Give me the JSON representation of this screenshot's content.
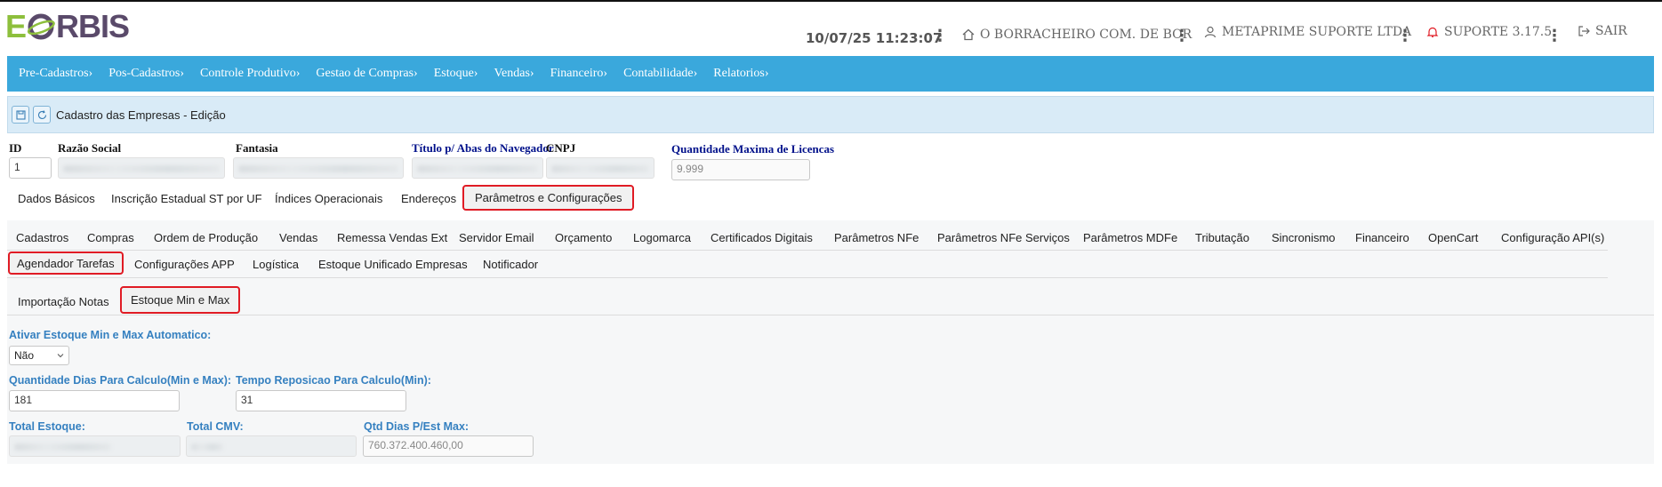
{
  "header": {
    "logo_e": "E",
    "logo_rest": "RBIS",
    "datetime": "10/07/25 11:23:07",
    "company": "O BORRACHEIRO COM. DE BOR",
    "user": "METAPRIME SUPORTE LTDA",
    "support": "SUPORTE 3.17.5",
    "logout": "SAIR"
  },
  "menu": [
    "Pre-Cadastros›",
    "Pos-Cadastros›",
    "Controle Produtivo›",
    "Gestao de Compras›",
    "Estoque›",
    "Vendas›",
    "Financeiro›",
    "Contabilidade›",
    "Relatorios›"
  ],
  "toolbar": {
    "title": "Cadastro das Empresas - Edição"
  },
  "fields": {
    "id_label": "ID",
    "id_value": "1",
    "razao_label": "Razão Social",
    "fantasia_label": "Fantasia",
    "titulo_label": "Título p/ Abas do Navegador",
    "cnpj_label": "CNPJ",
    "licencas_label": "Quantidade Maxima de Licencas",
    "licencas_placeholder": "9.999"
  },
  "main_tabs": [
    "Dados Básicos",
    "Inscrição Estadual ST por UF",
    "Índices Operacionais",
    "Endereços",
    "Parâmetros e Configurações"
  ],
  "param_tabs_row1": [
    "Cadastros",
    "Compras",
    "Ordem de Produção",
    "Vendas",
    "Remessa Vendas Ext",
    "Servidor Email",
    "Orçamento",
    "Logomarca",
    "Certificados Digitais",
    "Parâmetros NFe",
    "Parâmetros NFe Serviços",
    "Parâmetros MDFe",
    "Tributação",
    "Sincronismo",
    "Financeiro",
    "OpenCart",
    "Configuração API(s)"
  ],
  "param_tabs_row2": [
    "Agendador Tarefas",
    "Configurações APP",
    "Logística",
    "Estoque Unificado Empresas",
    "Notificador"
  ],
  "sub_tabs": [
    "Importação Notas",
    "Estoque Min e Max"
  ],
  "estoque": {
    "ativar_label": "Ativar Estoque Min e Max Automatico:",
    "ativar_value": "Não",
    "dias_label": "Quantidade Dias Para Calculo(Min e Max):",
    "dias_value": "181",
    "reposicao_label": "Tempo Reposicao Para Calculo(Min):",
    "reposicao_value": "31",
    "total_estoque_label": "Total Estoque:",
    "total_cmv_label": "Total CMV:",
    "qtd_dias_label": "Qtd Dias P/Est Max:",
    "qtd_dias_value": "760.372.400.460,00"
  },
  "colors": {
    "menu_bg": "#3aa8dc",
    "highlight": "#e01b24",
    "label_blue": "#3580c0",
    "toolbar_bg": "#d9ebf7"
  }
}
